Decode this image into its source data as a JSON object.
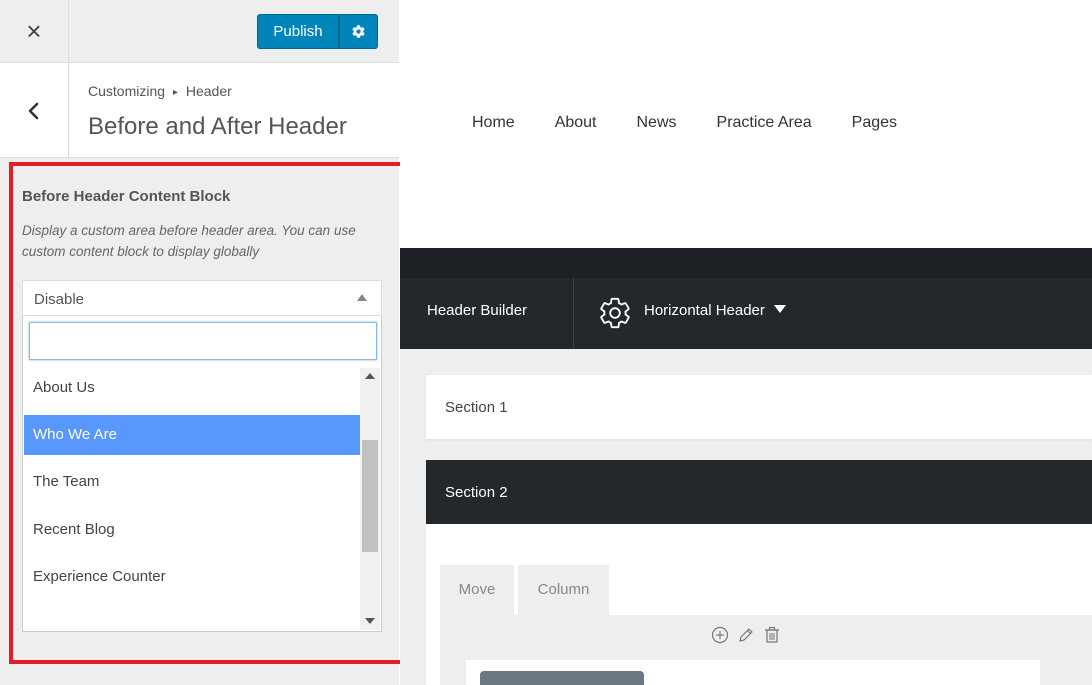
{
  "topbar": {
    "close_icon": "×",
    "publish_label": "Publish",
    "settings_icon": "gear-icon"
  },
  "section_header": {
    "breadcrumb_root": "Customizing",
    "breadcrumb_separator": "▸",
    "breadcrumb_current": "Header",
    "title": "Before and After Header"
  },
  "control": {
    "label": "Before Header Content Block",
    "description": "Display a custom area before header area. You can use custom content block to display globally",
    "selected": "Disable",
    "search_value": "",
    "options": [
      {
        "label": "About Us",
        "active": false
      },
      {
        "label": "Who We Are",
        "active": true
      },
      {
        "label": "The Team",
        "active": false
      },
      {
        "label": "Recent Blog",
        "active": false
      },
      {
        "label": "Experience Counter",
        "active": false
      }
    ]
  },
  "preview": {
    "nav": [
      "Home",
      "About",
      "News",
      "Practice Area",
      "Pages"
    ],
    "builder": {
      "title": "Header Builder",
      "layout": "Horizontal Header"
    },
    "sections": [
      {
        "label": "Section 1"
      },
      {
        "label": "Section 2"
      }
    ],
    "tabs": [
      "Move",
      "Column"
    ]
  },
  "colors": {
    "publish_bg": "#0085ba",
    "highlight_red": "#e41e26",
    "selected_option": "#5897fb",
    "builder_dark": "#23282d"
  }
}
